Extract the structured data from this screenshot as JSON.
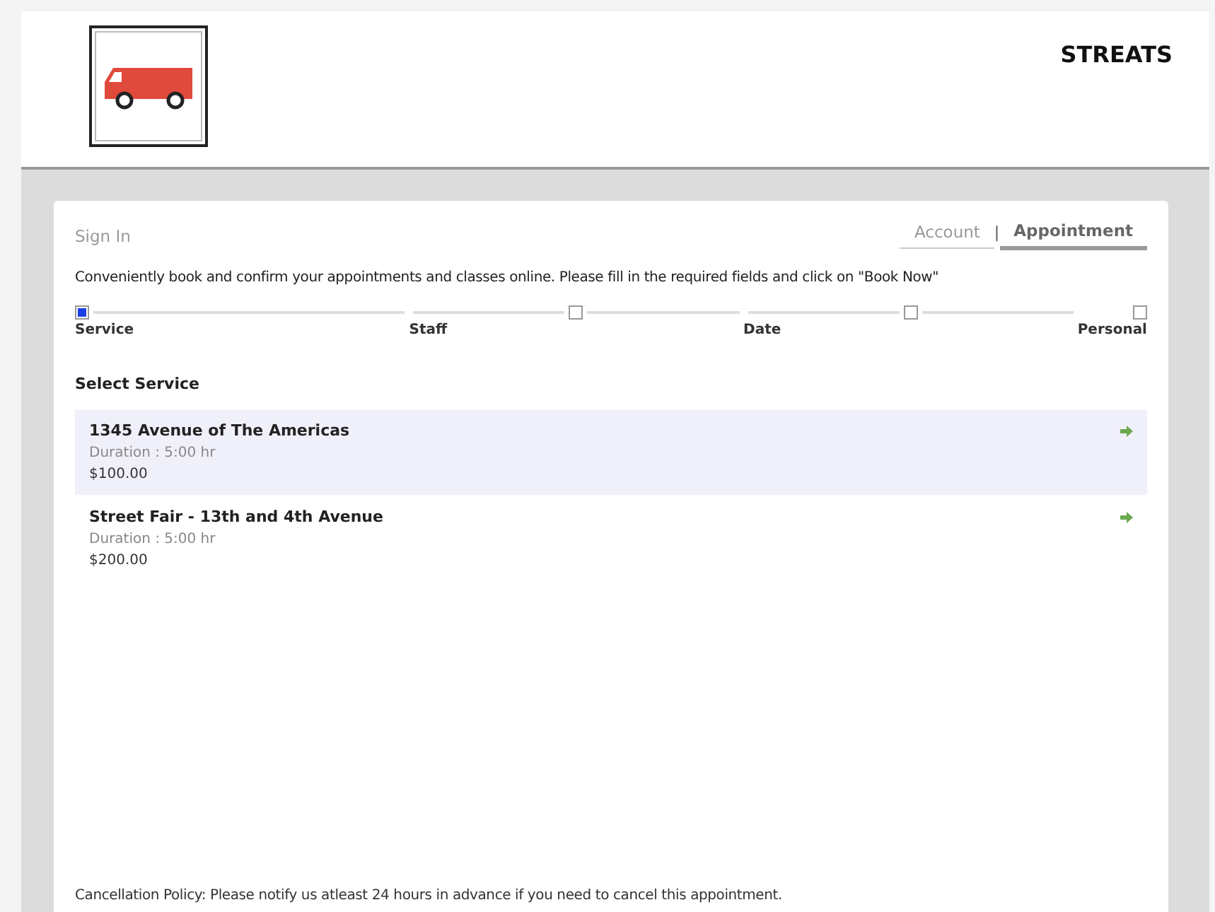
{
  "header": {
    "title": "STREATS"
  },
  "sign_in": "Sign In",
  "tabs": [
    {
      "label": "Account",
      "selected": false
    },
    {
      "label": "Appointment",
      "selected": true
    }
  ],
  "tab_separator": "|",
  "intro": "Conveniently book and confirm your appointments and classes online. Please fill in the required fields and click on \"Book Now\"",
  "steps": [
    {
      "label": "Service",
      "selected": true
    },
    {
      "label": "Staff",
      "selected": false
    },
    {
      "label": "Date",
      "selected": false
    },
    {
      "label": "Personal",
      "selected": false
    }
  ],
  "section_title": "Select Service",
  "services": [
    {
      "name": "1345 Avenue of The Americas",
      "duration": "Duration : 5:00 hr",
      "price": "$100.00",
      "selected": true
    },
    {
      "name": "Street Fair - 13th and 4th Avenue",
      "duration": "Duration : 5:00 hr",
      "price": "$200.00",
      "selected": false
    }
  ],
  "policy": "Cancellation Policy: Please notify us atleast 24 hours in advance if you need to cancel this appointment."
}
